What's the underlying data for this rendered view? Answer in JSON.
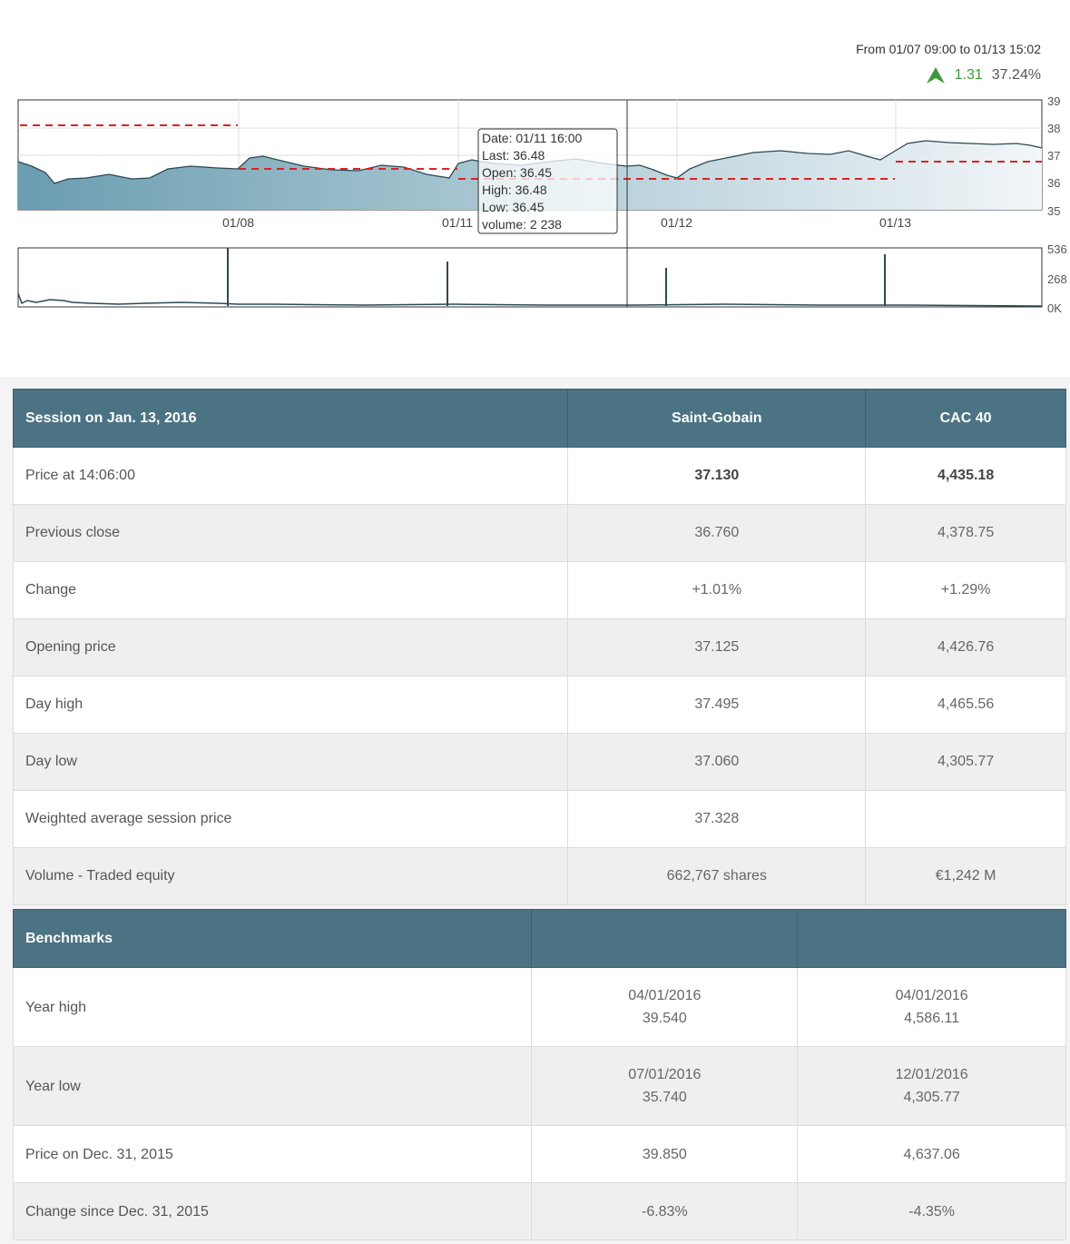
{
  "chart": {
    "range_text": "From 01/07 09:00 to 01/13 15:02",
    "change_abs": "1.31",
    "change_pct": "37.24%",
    "up_color": "#3a9a3a",
    "y_ticks": [
      "39",
      "38",
      "37",
      "36",
      "35"
    ],
    "x_ticks": [
      "01/08",
      "01/11",
      "01/12",
      "01/13"
    ],
    "vol_ticks": [
      "536",
      "268",
      "0K"
    ],
    "tooltip": {
      "date": "Date: 01/11 16:00",
      "last": "Last: 36.48",
      "open": "Open: 36.45",
      "high": "High: 36.48",
      "low": "Low: 36.45",
      "volume": "volume: 2 238"
    }
  },
  "session_table": {
    "headers": [
      "Session on Jan. 13, 2016",
      "Saint-Gobain",
      "CAC 40"
    ],
    "rows": [
      [
        "Price at 14:06:00",
        "37.130",
        "4,435.18"
      ],
      [
        "Previous close",
        "36.760",
        "4,378.75"
      ],
      [
        "Change",
        "+1.01%",
        "+1.29%"
      ],
      [
        "Opening price",
        "37.125",
        "4,426.76"
      ],
      [
        "Day high",
        "37.495",
        "4,465.56"
      ],
      [
        "Day low",
        "37.060",
        "4,305.77"
      ],
      [
        "Weighted average session price",
        "37.328",
        ""
      ],
      [
        "Volume - Traded equity",
        "662,767 shares",
        "€1,242 M"
      ]
    ]
  },
  "benchmarks_table": {
    "headers": [
      "Benchmarks",
      "",
      ""
    ],
    "rows": [
      {
        "label": "Year high",
        "sg_date": "04/01/2016",
        "sg_val": "39.540",
        "cac_date": "04/01/2016",
        "cac_val": "4,586.11"
      },
      {
        "label": "Year low",
        "sg_date": "07/01/2016",
        "sg_val": "35.740",
        "cac_date": "12/01/2016",
        "cac_val": "4,305.77"
      },
      {
        "label": "Price on Dec. 31, 2015",
        "sg_date": "",
        "sg_val": "39.850",
        "cac_date": "",
        "cac_val": "4,637.06"
      },
      {
        "label": "Change since Dec. 31, 2015",
        "sg_date": "",
        "sg_val": "-6.83%",
        "cac_date": "",
        "cac_val": "-4.35%"
      }
    ]
  }
}
